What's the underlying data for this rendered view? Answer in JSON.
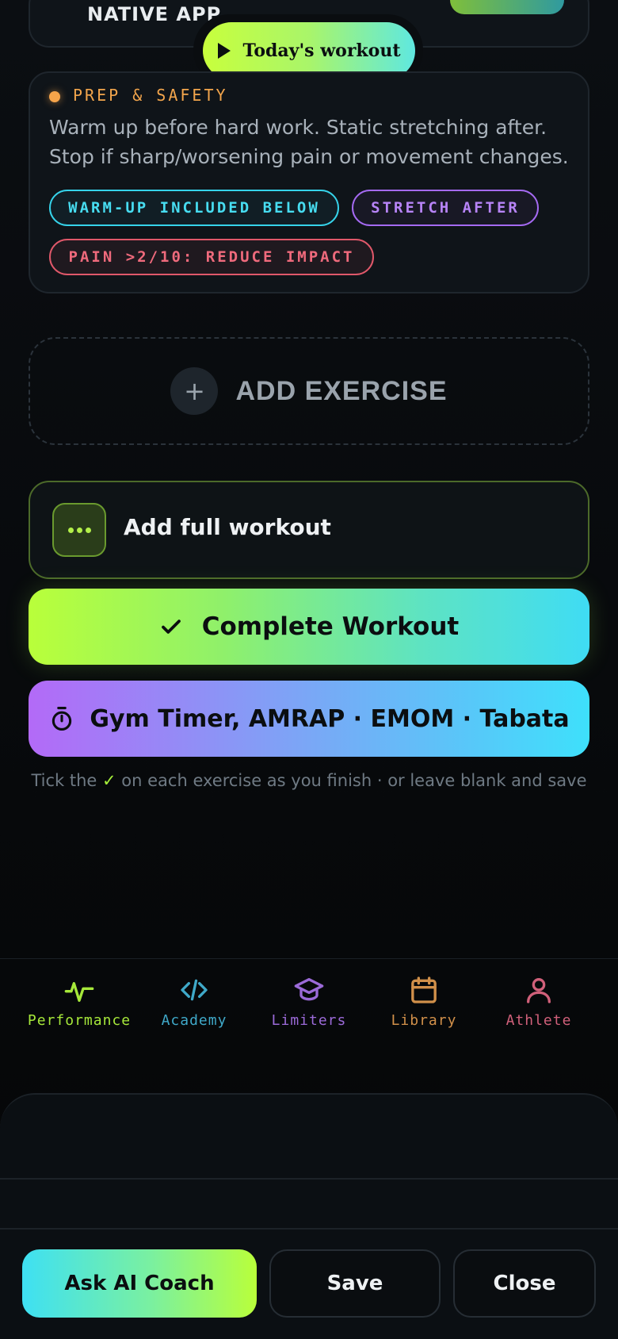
{
  "top_card": {
    "title": "NATIVE APP"
  },
  "today_button": {
    "label": "Today's workout",
    "icon": "play-icon"
  },
  "prep": {
    "title": "PREP & SAFETY",
    "text": "Warm up before hard work. Static stretching after. Stop if sharp/worsening pain or movement changes.",
    "tags": [
      {
        "label": "WARM-UP INCLUDED BELOW",
        "color": "#36d3ea"
      },
      {
        "label": "STRETCH AFTER",
        "color": "#a56af2"
      },
      {
        "label": "PAIN >2/10: REDUCE IMPACT",
        "color": "#e0586a"
      }
    ]
  },
  "add_exercise": {
    "label": "ADD EXERCISE",
    "icon": "plus-icon"
  },
  "add_full_workout": {
    "label": "Add full workout",
    "icon": "more-dots-icon"
  },
  "complete_workout": {
    "label": "Complete Workout",
    "icon": "check-icon"
  },
  "gym_timer": {
    "label": "Gym Timer, AMRAP · EMOM · Tabata",
    "icon": "stopwatch-icon"
  },
  "hint": {
    "before": "Tick the ",
    "tick": "✓",
    "after": " on each exercise as you finish · or leave blank and save"
  },
  "nav": [
    {
      "label": "Performance",
      "icon": "activity-icon",
      "color": "#a6e83a"
    },
    {
      "label": "Academy",
      "icon": "code-icon",
      "color": "#3fa9c9"
    },
    {
      "label": "Limiters",
      "icon": "graduation-cap-icon",
      "color": "#9b6ad8"
    },
    {
      "label": "Library",
      "icon": "calendar-icon",
      "color": "#d1904a"
    },
    {
      "label": "Athlete",
      "icon": "user-icon",
      "color": "#d0607a"
    }
  ],
  "footer": {
    "ask_ai": "Ask AI Coach",
    "save": "Save",
    "close": "Close"
  },
  "colors": {
    "accent_lime": "#b9ff3a",
    "accent_cyan": "#3ee0f3",
    "accent_purple": "#b36af7",
    "background": "#0b0e12"
  }
}
